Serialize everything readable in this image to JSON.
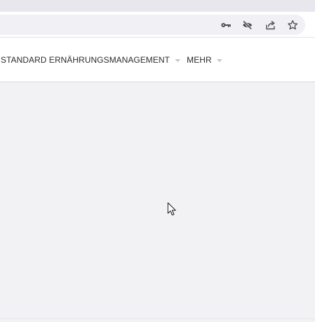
{
  "browser": {
    "omnibox_icons": [
      "key-icon",
      "eye-off-icon",
      "share-icon",
      "star-icon"
    ]
  },
  "nav": {
    "items": [
      {
        "label": "STANDARD ERNÄHRUNGSMANAGEMENT",
        "has_dropdown": true
      },
      {
        "label": "MEHR",
        "has_dropdown": true
      }
    ]
  },
  "colors": {
    "page_background": "#f2f1f4",
    "nav_background": "#ffffff",
    "chrome_background": "#e8e7ee",
    "nav_text": "#2b2b2b"
  }
}
